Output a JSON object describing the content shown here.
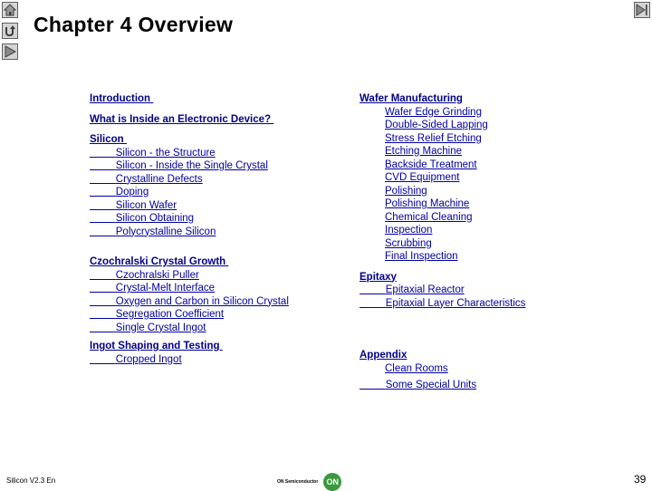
{
  "nav": {
    "home_icon": "home-icon",
    "return_icon": "return-icon",
    "next_icon": "play-next-icon",
    "last_icon": "skip-to-end-icon"
  },
  "title": "Chapter 4 Overview",
  "left_column": {
    "introduction": "Introduction ",
    "inside_device": "What is Inside an Electronic Device? ",
    "silicon": {
      "heading": "Silicon ",
      "items": [
        "Silicon - the Structure",
        "Silicon - Inside the Single Crystal",
        "Crystalline Defects",
        "Doping",
        "Silicon Wafer",
        "Silicon Obtaining",
        "Polycrystalline Silicon"
      ]
    },
    "czochralski": {
      "heading": "Czochralski Crystal Growth ",
      "items": [
        "Czochralski Puller",
        "Crystal-Melt Interface",
        "Oxygen and Carbon in Silicon Crystal",
        "Segregation Coefficient",
        "Single Crystal Ingot"
      ]
    },
    "ingot": {
      "heading": "Ingot Shaping and Testing ",
      "items": [
        "Cropped Ingot"
      ]
    }
  },
  "right_column": {
    "wafer": {
      "heading": "Wafer Manufacturing",
      "items": [
        "Wafer Edge Grinding",
        "Double-Sided Lapping",
        "Stress Relief Etching",
        "Etching Machine",
        "Backside Treatment",
        "CVD Equipment",
        "Polishing",
        "Polishing Machine",
        "Chemical Cleaning",
        "Inspection",
        "Scrubbing",
        "Final Inspection"
      ]
    },
    "epitaxy": {
      "heading": "Epitaxy",
      "items": [
        "Epitaxial Reactor",
        "Epitaxial Layer Characteristics"
      ]
    },
    "appendix": {
      "heading": "Appendix",
      "items": [
        "Clean Rooms",
        "Some Special Units"
      ]
    }
  },
  "footer": {
    "version": "Silicon V2.3 En",
    "brand": "ON Semiconductor",
    "logo_text": "ON",
    "page_number": "39"
  },
  "colors": {
    "link": "#0000a0",
    "heading_link": "#00008b",
    "logo_green": "#3a9a3a"
  }
}
